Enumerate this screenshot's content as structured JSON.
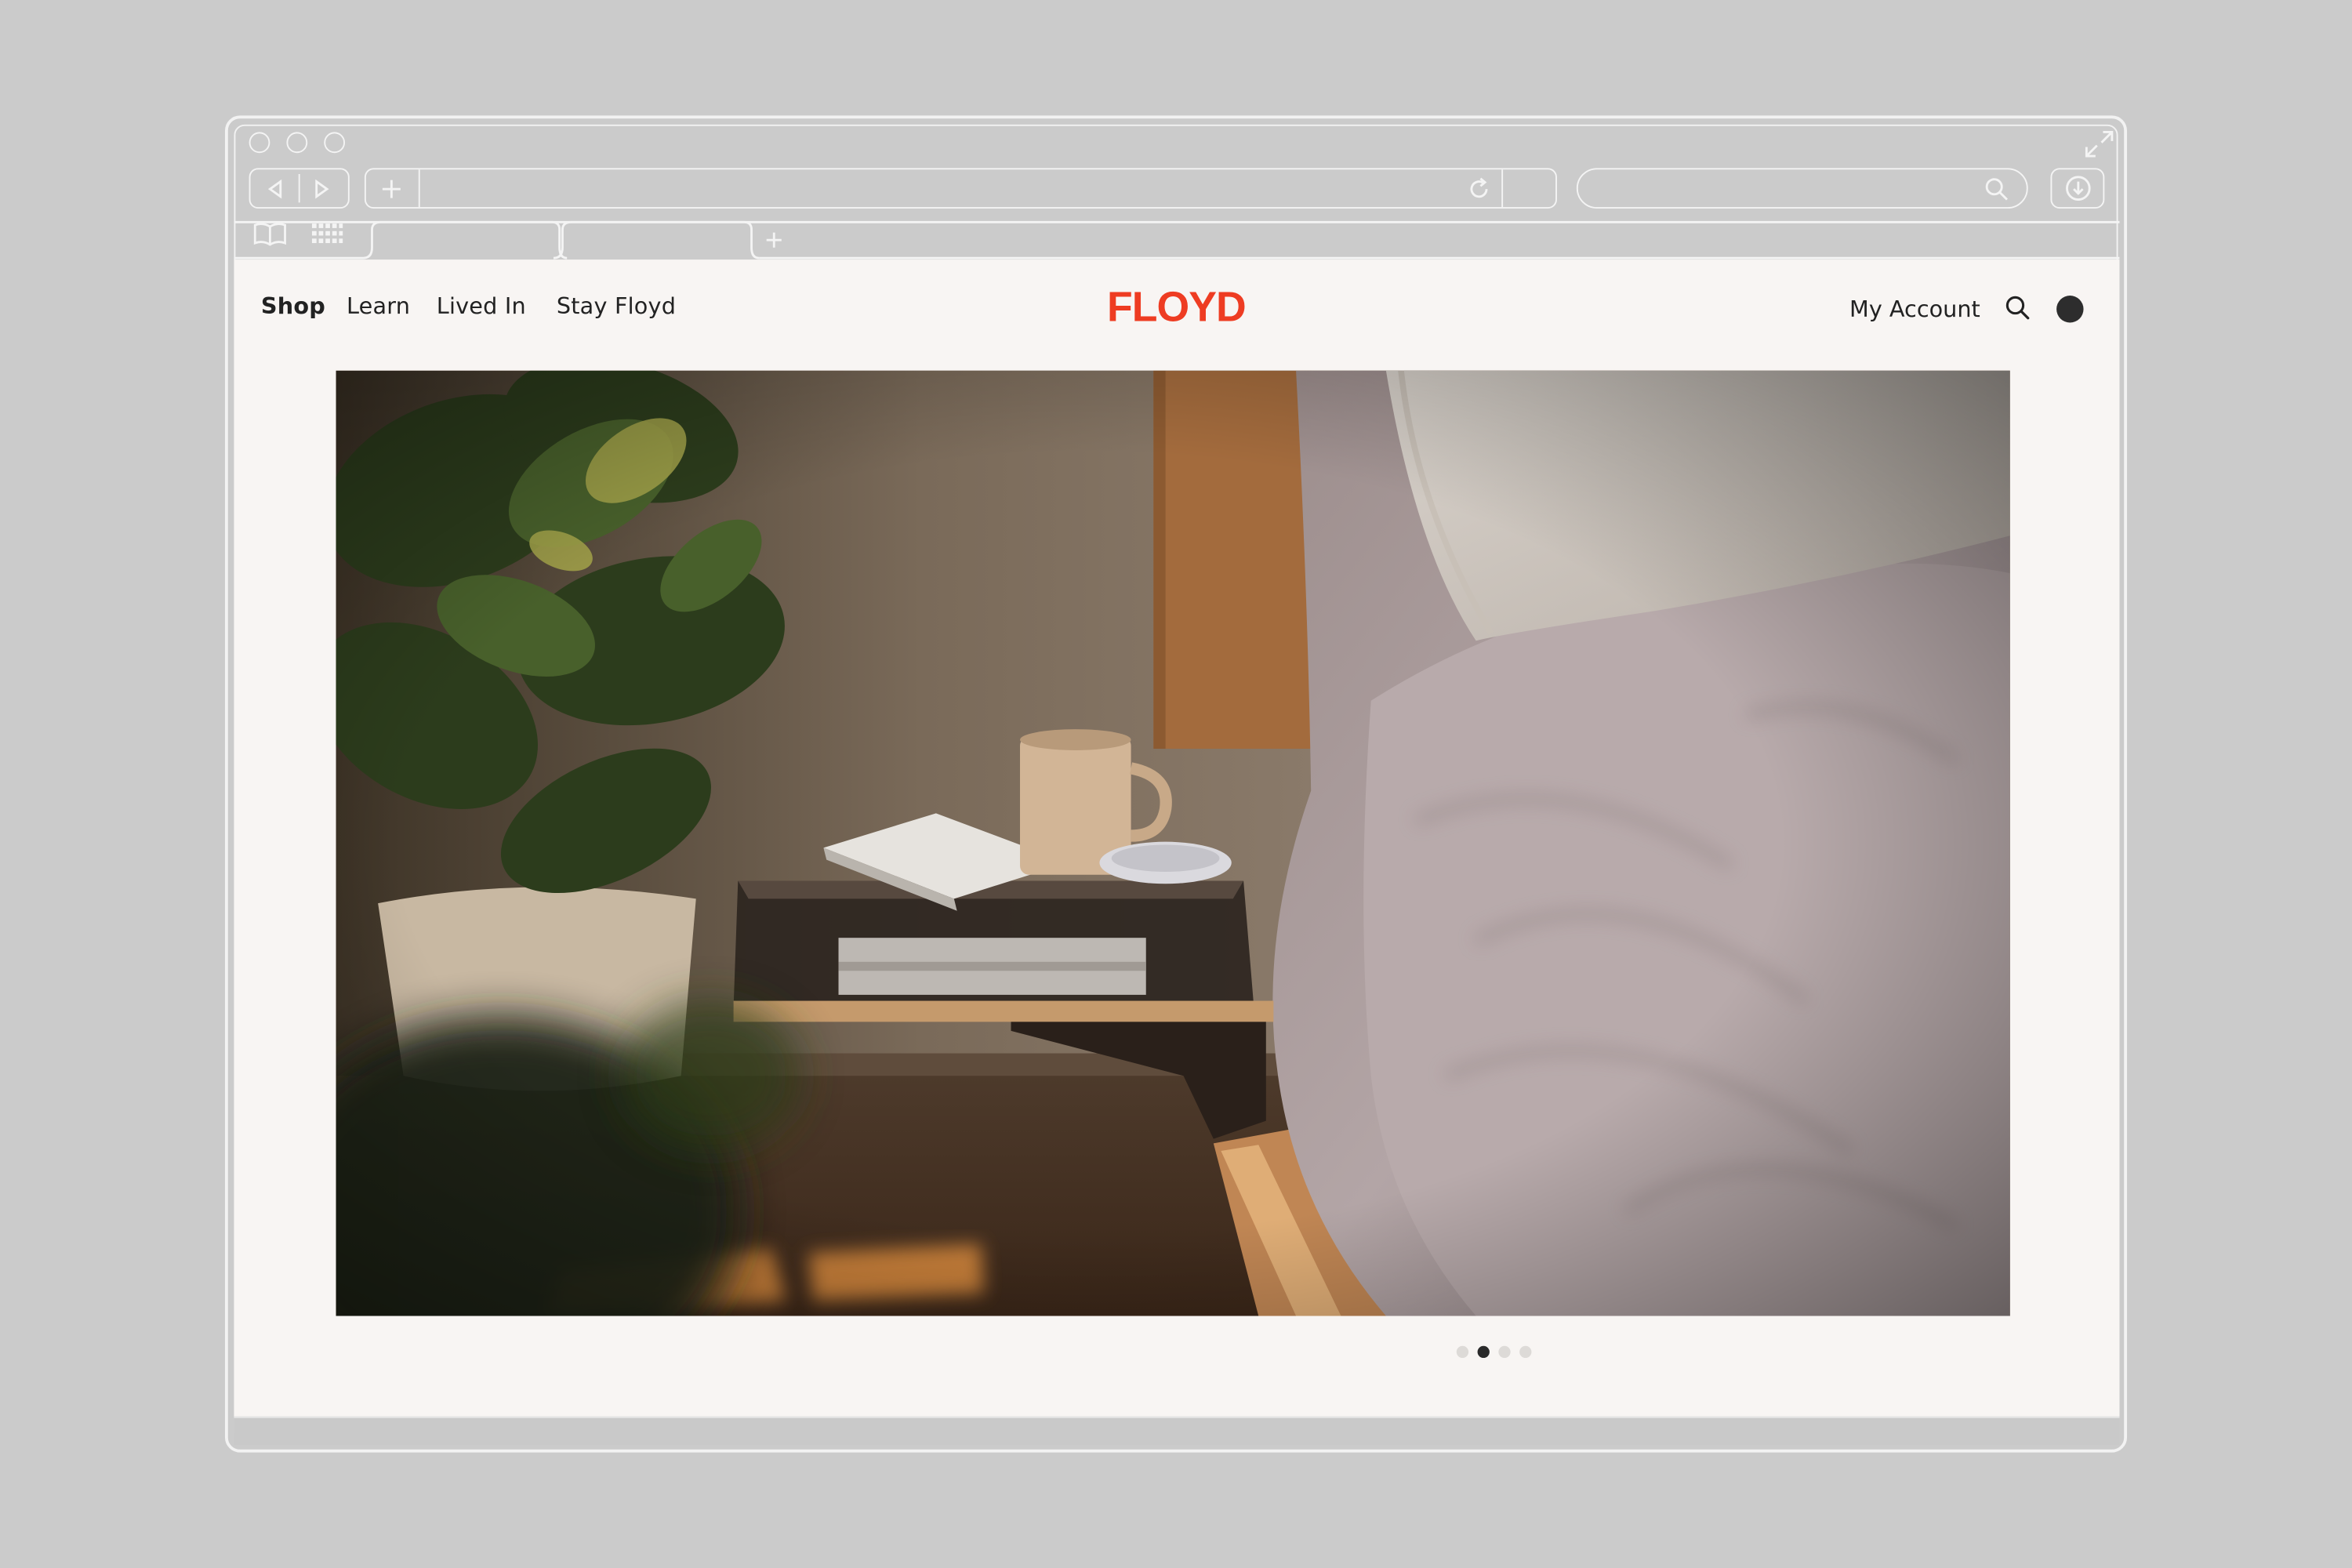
{
  "site": {
    "nav": [
      {
        "label": "Shop",
        "active": true
      },
      {
        "label": "Learn",
        "active": false
      },
      {
        "label": "Lived In",
        "active": false
      },
      {
        "label": "Stay Floyd",
        "active": false
      }
    ],
    "logo": "FLOYD",
    "account_label": "My Account",
    "brand_color": "#ee3c22",
    "hero": {
      "scene": "bedside table with mug, books and plant next to bed",
      "carousel_total": 4,
      "carousel_active": 2
    }
  },
  "browser": {
    "icons": [
      "back-icon",
      "forward-icon",
      "new-tab-icon",
      "reload-icon",
      "search-icon",
      "download-icon",
      "bookmarks-icon",
      "grid-icon",
      "fullscreen-icon"
    ]
  }
}
